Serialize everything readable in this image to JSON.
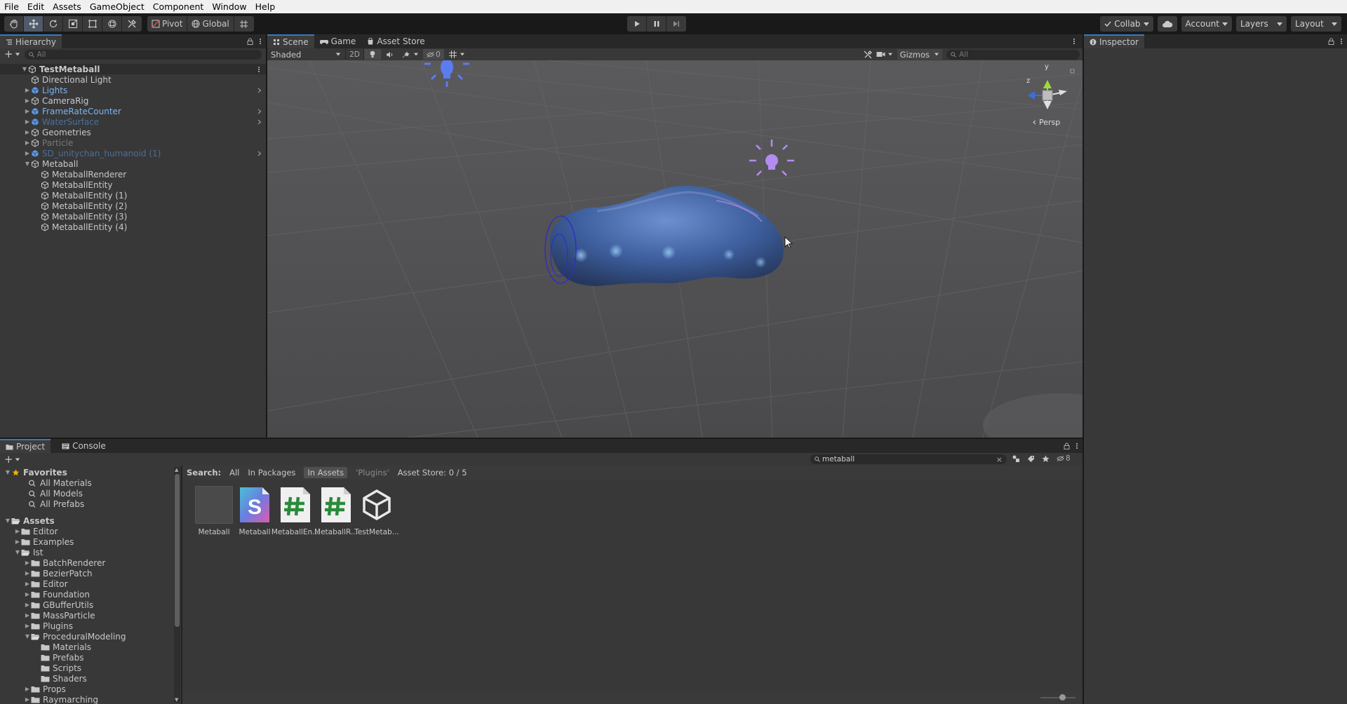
{
  "menu": [
    "File",
    "Edit",
    "Assets",
    "GameObject",
    "Component",
    "Window",
    "Help"
  ],
  "toolbar": {
    "pivot": "Pivot",
    "global": "Global",
    "collab": "Collab",
    "account": "Account",
    "layers": "Layers",
    "layout": "Layout"
  },
  "hierarchy": {
    "tab": "Hierarchy",
    "search_placeholder": "All",
    "root": "TestMetaball",
    "items": [
      {
        "label": "Directional Light",
        "depth": 1,
        "arrow": false,
        "style": "normal"
      },
      {
        "label": "Lights",
        "depth": 1,
        "arrow": true,
        "style": "prefab",
        "more": true
      },
      {
        "label": "CameraRig",
        "depth": 1,
        "arrow": true,
        "style": "normal"
      },
      {
        "label": "FrameRateCounter",
        "depth": 1,
        "arrow": true,
        "style": "prefab",
        "more": true
      },
      {
        "label": "WaterSurface",
        "depth": 1,
        "arrow": true,
        "style": "prefab-dim",
        "more": true
      },
      {
        "label": "Geometries",
        "depth": 1,
        "arrow": true,
        "style": "normal"
      },
      {
        "label": "Particle",
        "depth": 1,
        "arrow": true,
        "style": "dim"
      },
      {
        "label": "SD_unitychan_humanoid (1)",
        "depth": 1,
        "arrow": true,
        "style": "prefab-dim",
        "more": true
      },
      {
        "label": "Metaball",
        "depth": 1,
        "arrow": true,
        "expanded": true,
        "style": "normal"
      },
      {
        "label": "MetaballRenderer",
        "depth": 2,
        "arrow": false,
        "style": "normal"
      },
      {
        "label": "MetaballEntity",
        "depth": 2,
        "arrow": false,
        "style": "normal"
      },
      {
        "label": "MetaballEntity (1)",
        "depth": 2,
        "arrow": false,
        "style": "normal"
      },
      {
        "label": "MetaballEntity (2)",
        "depth": 2,
        "arrow": false,
        "style": "normal"
      },
      {
        "label": "MetaballEntity (3)",
        "depth": 2,
        "arrow": false,
        "style": "normal"
      },
      {
        "label": "MetaballEntity (4)",
        "depth": 2,
        "arrow": false,
        "style": "normal"
      }
    ]
  },
  "scene": {
    "tabs": [
      "Scene",
      "Game",
      "Asset Store"
    ],
    "shading_mode": "Shaded",
    "mode_2d": "2D",
    "hidden_count": "0",
    "gizmos": "Gizmos",
    "search_placeholder": "All",
    "gizmo_y": "y",
    "gizmo_z": "z",
    "persp": "Persp"
  },
  "inspector": {
    "tab": "Inspector"
  },
  "bottom": {
    "tabs": [
      "Project",
      "Console"
    ],
    "search_value": "metaball",
    "hidden_count": "8",
    "search_label": "Search:",
    "scopes": [
      "All",
      "In Packages",
      "In Assets",
      "'Plugins'",
      "Asset Store: 0 / 5"
    ]
  },
  "project_tree": [
    {
      "label": "Favorites",
      "depth": 0,
      "kind": "favorites",
      "expanded": true
    },
    {
      "label": "All Materials",
      "depth": 1,
      "kind": "search"
    },
    {
      "label": "All Models",
      "depth": 1,
      "kind": "search"
    },
    {
      "label": "All Prefabs",
      "depth": 1,
      "kind": "search"
    },
    {
      "label": "Assets",
      "depth": 0,
      "kind": "assets",
      "expanded": true,
      "gap": true
    },
    {
      "label": "Editor",
      "depth": 1,
      "kind": "folder",
      "arrow": true
    },
    {
      "label": "Examples",
      "depth": 1,
      "kind": "folder",
      "arrow": true
    },
    {
      "label": "Ist",
      "depth": 1,
      "kind": "folder-open",
      "arrow": true,
      "expanded": true
    },
    {
      "label": "BatchRenderer",
      "depth": 2,
      "kind": "folder",
      "arrow": true
    },
    {
      "label": "BezierPatch",
      "depth": 2,
      "kind": "folder",
      "arrow": true
    },
    {
      "label": "Editor",
      "depth": 2,
      "kind": "folder",
      "arrow": true
    },
    {
      "label": "Foundation",
      "depth": 2,
      "kind": "folder",
      "arrow": true
    },
    {
      "label": "GBufferUtils",
      "depth": 2,
      "kind": "folder",
      "arrow": true
    },
    {
      "label": "MassParticle",
      "depth": 2,
      "kind": "folder",
      "arrow": true
    },
    {
      "label": "Plugins",
      "depth": 2,
      "kind": "folder",
      "arrow": true
    },
    {
      "label": "ProceduralModeling",
      "depth": 2,
      "kind": "folder-open",
      "arrow": true,
      "expanded": true
    },
    {
      "label": "Materials",
      "depth": 3,
      "kind": "folder"
    },
    {
      "label": "Prefabs",
      "depth": 3,
      "kind": "folder"
    },
    {
      "label": "Scripts",
      "depth": 3,
      "kind": "folder"
    },
    {
      "label": "Shaders",
      "depth": 3,
      "kind": "folder"
    },
    {
      "label": "Props",
      "depth": 2,
      "kind": "folder",
      "arrow": true
    },
    {
      "label": "Raymarching",
      "depth": 2,
      "kind": "folder",
      "arrow": true
    }
  ],
  "assets": [
    {
      "label": "Metaball",
      "kind": "material"
    },
    {
      "label": "Metaball",
      "kind": "shader"
    },
    {
      "label": "MetaballEn...",
      "kind": "script"
    },
    {
      "label": "MetaballR...",
      "kind": "script"
    },
    {
      "label": "TestMetab...",
      "kind": "scene"
    }
  ],
  "colors": {
    "accent": "#3a79bb",
    "prefab": "#7cb4f2",
    "prefab_dim": "#4a6f99",
    "light_icon": "#5a7cf0",
    "light_icon_pink": "#b28cf0",
    "metaball": "#3c5f9a"
  }
}
